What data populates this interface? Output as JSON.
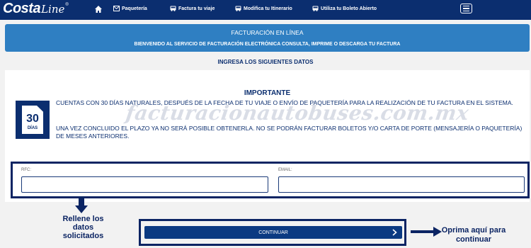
{
  "brand": {
    "name_bold": "Costa",
    "name_script": "Line",
    "reg": "®"
  },
  "nav": {
    "items": [
      {
        "label": "Paquetería",
        "icon": "envelope-icon"
      },
      {
        "label": "Factura tu viaje",
        "icon": "bus-icon"
      },
      {
        "label": "Modifica tu Itinerario",
        "icon": "bus-icon"
      },
      {
        "label": "Utiliza tu Boleto Abierto",
        "icon": "bus-icon"
      }
    ]
  },
  "banner": {
    "title": "FACTURACIÓN EN LÍNEA",
    "subtitle": "BIENVENIDO AL SERVICIO DE FACTURACIÓN ELECTRÓNICA CONSULTA, IMPRIME O DESCARGA TU FACTURA"
  },
  "form_heading": "INGRESA LOS SIGUIENTES DATOS",
  "notice": {
    "title": "IMPORTANTE",
    "days_number": "30",
    "days_label": "DÍAS",
    "paragraph_1": "CUENTAS CON 30 DÍAS NATURALES, DESPUÉS DE LA FECHA DE TU VIAJE O ENVÍO DE PAQUETERÍA PARA LA REALIZACIÓN DE TU FACTURA EN EL SISTEMA.",
    "paragraph_2": "UNA VEZ CONCLUIDO EL PLAZO YA NO SERÁ POSIBLE OBTENERLA. NO SE PODRÁN FACTURAR BOLETOS Y/O CARTA DE PORTE (MENSAJERÍA O PAQUETERÍA) DE MESES ANTERIORES."
  },
  "watermark": "facturacionautobuses.com.mx",
  "form": {
    "rfc_label": "RFC:",
    "rfc_value": "",
    "email_label": "EMAIL:",
    "email_value": ""
  },
  "continue_label": "CONTINUAR",
  "annotations": {
    "left": "Rellene los datos solicitados",
    "right": "Oprima aquí para continuar"
  },
  "colors": {
    "navbar": "#0b2e6f",
    "banner": "#2f7fc2",
    "button": "#0b3a82",
    "frame": "#0b2463"
  }
}
